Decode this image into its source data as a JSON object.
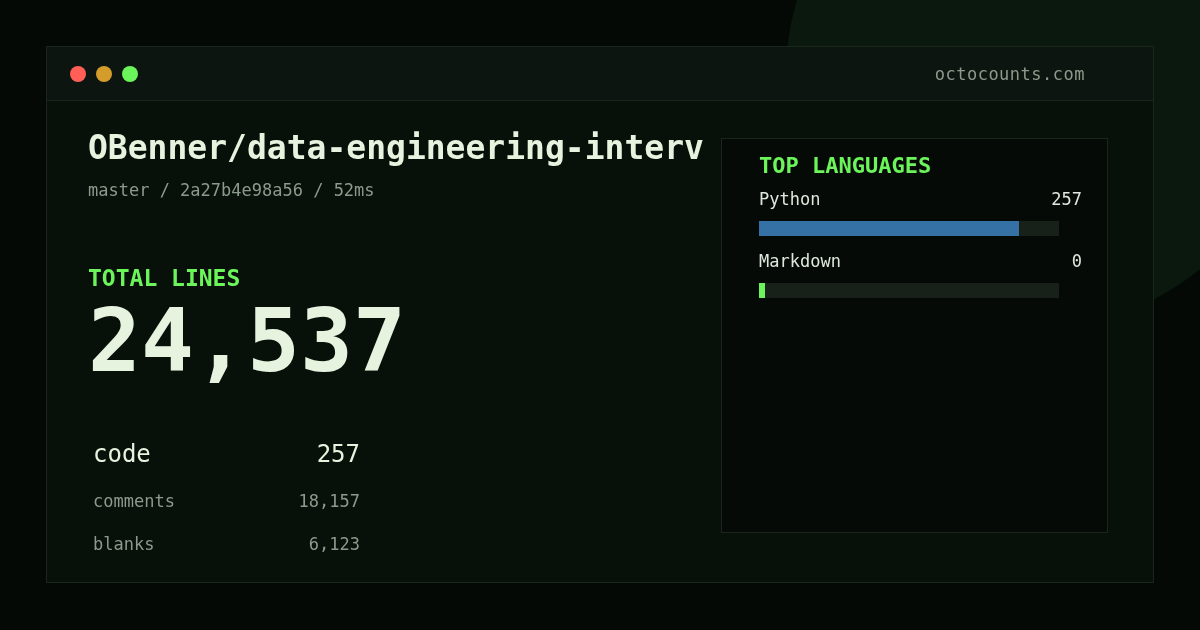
{
  "window": {
    "url": "octocounts.com"
  },
  "repo": {
    "title": "OBenner/data-engineering-interv",
    "meta": "master / 2a27b4e98a56 / 52ms"
  },
  "total": {
    "label": "TOTAL LINES",
    "value": "24,537"
  },
  "breakdown": [
    {
      "kind": "primary",
      "label": "code",
      "value": "257"
    },
    {
      "kind": "secondary",
      "label": "comments",
      "value": "18,157"
    },
    {
      "kind": "secondary",
      "label": "blanks",
      "value": "6,123"
    }
  ],
  "languages": {
    "title": "TOP LANGUAGES",
    "items": [
      {
        "name": "Python",
        "count": "257",
        "level": 0.867,
        "color": "#3571a5"
      },
      {
        "name": "Markdown",
        "count": "0",
        "level": 0.02,
        "color": "#6cf55a"
      }
    ]
  }
}
